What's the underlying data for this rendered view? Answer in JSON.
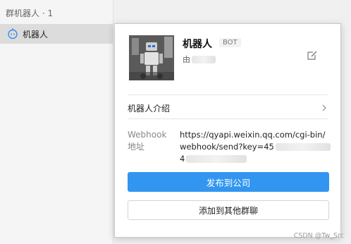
{
  "sidebar": {
    "group_header": "群机器人 · 1",
    "bot_item": {
      "label": "机器人",
      "icon": "robot-icon"
    }
  },
  "card": {
    "avatar_icon": "robot-photo",
    "name": "机器人",
    "badge": "BOT",
    "creator_prefix": "由",
    "edit_icon": "edit-icon",
    "intro_label": "机器人介绍",
    "intro_icon": "chevron-right-icon",
    "webhook_label": "Webhook 地址",
    "webhook_line1": "https://qyapi.weixin.qq.com/cgi-bin/",
    "webhook_line2": "webhook/send?key=45",
    "webhook_line3": "4",
    "publish_button": "发布到公司",
    "add_group_button": "添加到其他群聊"
  },
  "watermark": "CSDN @Tw_Src",
  "colors": {
    "primary": "#3296f0",
    "sidebar_bg": "#f5f5f5",
    "selected_row": "#dcdcdc",
    "robot_icon": "#3a8ee6"
  }
}
